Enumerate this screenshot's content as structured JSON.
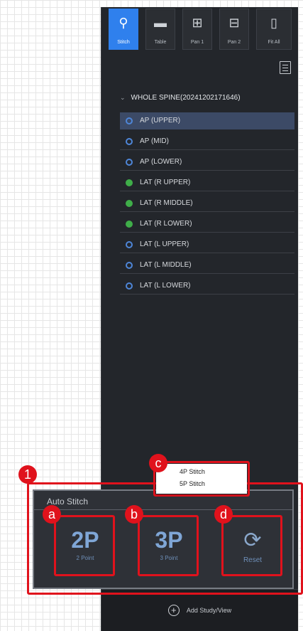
{
  "toolbar": {
    "buttons": [
      {
        "label": "Stitch",
        "icon": "spine-icon",
        "glyph": "⚲"
      },
      {
        "label": "Table",
        "icon": "dash-icon",
        "glyph": "▬"
      },
      {
        "label": "Pan 1",
        "icon": "grid-icon",
        "glyph": "⊞"
      },
      {
        "label": "Pan 2",
        "icon": "split-icon",
        "glyph": "⊟"
      },
      {
        "label": "Fit All",
        "icon": "fit-icon",
        "glyph": "▯"
      }
    ]
  },
  "series": {
    "header": "WHOLE SPINE(20241202171646)",
    "items": [
      {
        "label": "AP (UPPER)",
        "selected": true,
        "status": "blue"
      },
      {
        "label": "AP (MID)",
        "status": "blue"
      },
      {
        "label": "AP (LOWER)",
        "status": "blue"
      },
      {
        "label": "LAT (R UPPER)",
        "status": "green"
      },
      {
        "label": "LAT (R MIDDLE)",
        "status": "green"
      },
      {
        "label": "LAT (R LOWER)",
        "status": "green"
      },
      {
        "label": "LAT (L UPPER)",
        "status": "blue"
      },
      {
        "label": "LAT (L MIDDLE)",
        "status": "blue"
      },
      {
        "label": "LAT (L LOWER)",
        "status": "blue"
      }
    ]
  },
  "autostitch": {
    "title": "Auto Stitch",
    "btn2p": {
      "big": "2P",
      "small": "2 Point"
    },
    "btn3p": {
      "big": "3P",
      "small": "3 Point"
    },
    "reset": {
      "label": "Reset"
    }
  },
  "popup": {
    "items": [
      "4P Stitch",
      "5P Stitch"
    ]
  },
  "callouts": {
    "n1": "1",
    "a": "a",
    "b": "b",
    "c": "c",
    "d": "d"
  },
  "addbar": {
    "label": "Add Study/View"
  },
  "colors": {
    "accent": "#2f80ed",
    "callout": "#e0121c",
    "panel": "#23262b"
  }
}
